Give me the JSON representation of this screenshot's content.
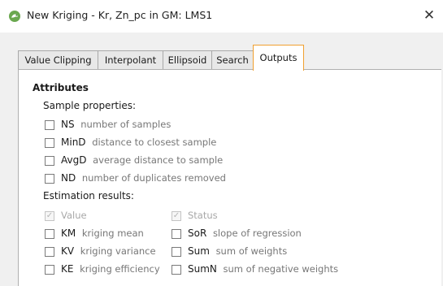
{
  "window": {
    "title": "New Kriging - Kr, Zn_pc in GM: LMS1",
    "close_symbol": "✕",
    "app_icon": "leapfrog-logo-icon",
    "accent": "#6aa84f"
  },
  "tabs": [
    {
      "label": "Value Clipping",
      "active": false
    },
    {
      "label": "Interpolant",
      "active": false
    },
    {
      "label": "Ellipsoid",
      "active": false
    },
    {
      "label": "Search",
      "active": false
    },
    {
      "label": "Outputs",
      "active": true
    }
  ],
  "outputs": {
    "attributes_heading": "Attributes",
    "sample_properties_label": "Sample properties:",
    "sample_properties": [
      {
        "code": "NS",
        "desc": "number of samples",
        "checked": false
      },
      {
        "code": "MinD",
        "desc": "distance to closest sample",
        "checked": false
      },
      {
        "code": "AvgD",
        "desc": "average distance to sample",
        "checked": false
      },
      {
        "code": "ND",
        "desc": "number of duplicates removed",
        "checked": false
      }
    ],
    "estimation_results_label": "Estimation results:",
    "value": {
      "label": "Value",
      "checked": true,
      "disabled": true
    },
    "status": {
      "label": "Status",
      "checked": true,
      "disabled": true
    },
    "left_column": [
      {
        "code": "KM",
        "desc": "kriging mean",
        "checked": false
      },
      {
        "code": "KV",
        "desc": "kriging variance",
        "checked": false
      },
      {
        "code": "KE",
        "desc": "kriging efficiency",
        "checked": false
      }
    ],
    "right_column": [
      {
        "code": "SoR",
        "desc": "slope of regression",
        "checked": false
      },
      {
        "code": "Sum",
        "desc": "sum of weights",
        "checked": false
      },
      {
        "code": "SumN",
        "desc": "sum of negative weights",
        "checked": false
      }
    ],
    "checkmark_symbol": "✓"
  }
}
